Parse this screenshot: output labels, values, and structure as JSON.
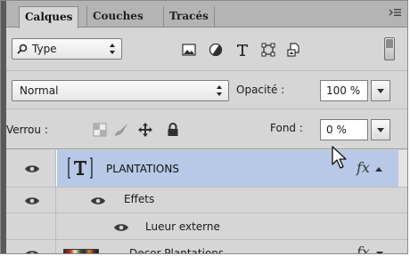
{
  "tabs": [
    {
      "label": "Calques",
      "active": true
    },
    {
      "label": "Couches",
      "active": false
    },
    {
      "label": "Tracés",
      "active": false
    }
  ],
  "icons": {
    "panel_menu": "panel-menu-icon",
    "filter_search": "magnifier-icon",
    "filter_types": [
      "image-filter-icon",
      "adjustment-filter-icon",
      "text-filter-icon",
      "shape-filter-icon",
      "smart-object-filter-icon"
    ],
    "lock_types": [
      "lock-transparent-pixels-icon",
      "lock-image-pixels-icon",
      "lock-position-icon",
      "lock-all-icon"
    ]
  },
  "filter": {
    "value": "Type"
  },
  "blend": {
    "mode": "Normal",
    "opacity_label": "Opacité :",
    "opacity_value": "100 %"
  },
  "lock": {
    "label": "Verrou :",
    "fill_label": "Fond :",
    "fill_value": "0 %"
  },
  "layers": {
    "plantations": {
      "name": "PLANTATIONS",
      "fx": "fx",
      "selected": true
    },
    "effects_label": "Effets",
    "glow_label": "Lueur externe",
    "decor": {
      "name": "Decor Plantations",
      "fx": "fx"
    }
  },
  "colors": {
    "selection": "#b7c9e6",
    "panel": "#d6d6d6",
    "tabbar": "#b4b4b4"
  }
}
